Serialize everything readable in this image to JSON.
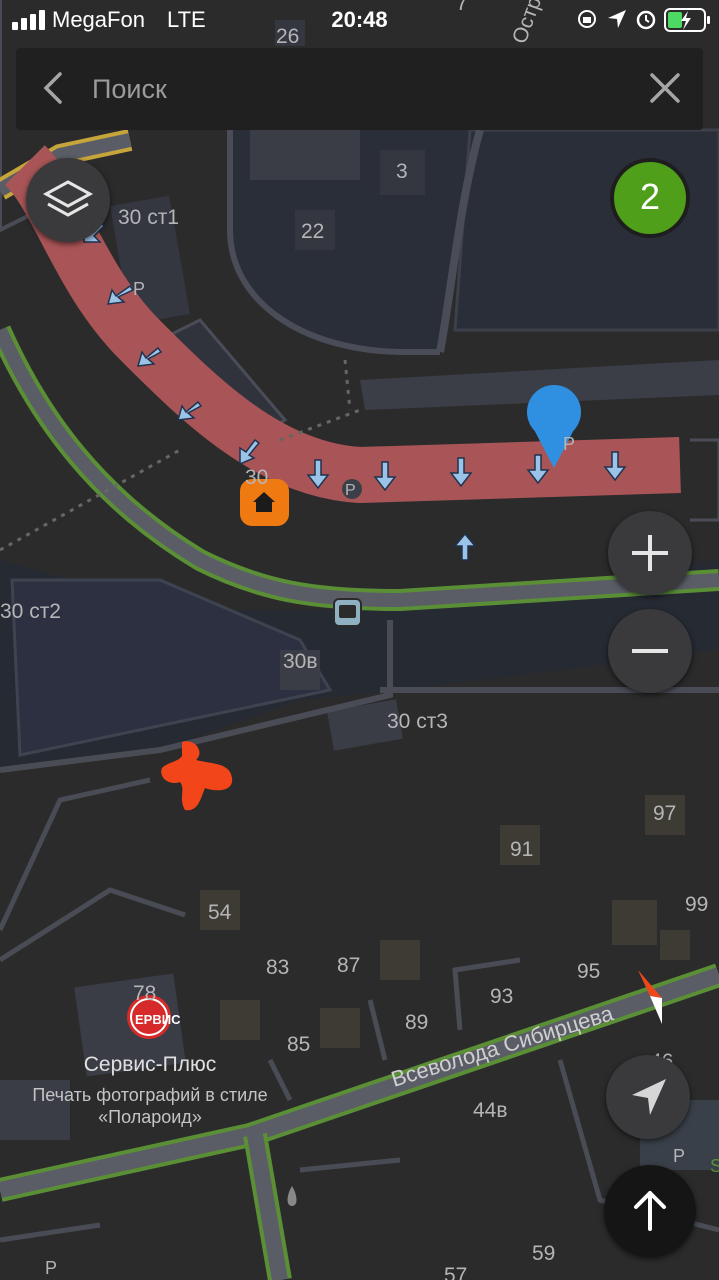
{
  "status_bar": {
    "carrier": "MegaFon",
    "network": "LTE",
    "time": "20:48"
  },
  "search": {
    "placeholder": "Поиск"
  },
  "traffic_badge": {
    "value": "2",
    "color": "#4f9f1b"
  },
  "map": {
    "route_color": "#a95557",
    "pin_color": "#2f8fe0",
    "house_icon_color": "#f07a12",
    "labels": {
      "l_30st1": "30 ст1",
      "l_30st2": "30 ст2",
      "l_30st3": "30 ст3",
      "l_30v": "30в",
      "l_30": "30",
      "l_3": "3",
      "l_22": "22",
      "l_26": "26",
      "l_7": "7",
      "l_54": "54",
      "l_83": "83",
      "l_87": "87",
      "l_85": "85",
      "l_89": "89",
      "l_91": "91",
      "l_93": "93",
      "l_95": "95",
      "l_97": "97",
      "l_99": "99",
      "l_46": "46",
      "l_44v": "44в",
      "l_59": "59",
      "l_57": "57",
      "l_78": "78",
      "l_ostr": "Остро",
      "l_p1": "P",
      "l_p2": "P",
      "l_p3": "P",
      "l_p4": "P",
      "l_p5": "P",
      "l_s": "S",
      "street": "Всеволода Сибирцева"
    },
    "poi": {
      "logo_text": "ЕРВИС",
      "name": "Сервис-Плюс",
      "desc_line1": "Печать фотографий в стиле",
      "desc_line2": "«Полароид»"
    }
  },
  "controls": {
    "layers": "layers-icon",
    "zoom_in": "plus-icon",
    "zoom_out": "minus-icon",
    "compass": "compass-icon",
    "locate": "location-arrow-icon",
    "route": "arrow-up-icon"
  }
}
